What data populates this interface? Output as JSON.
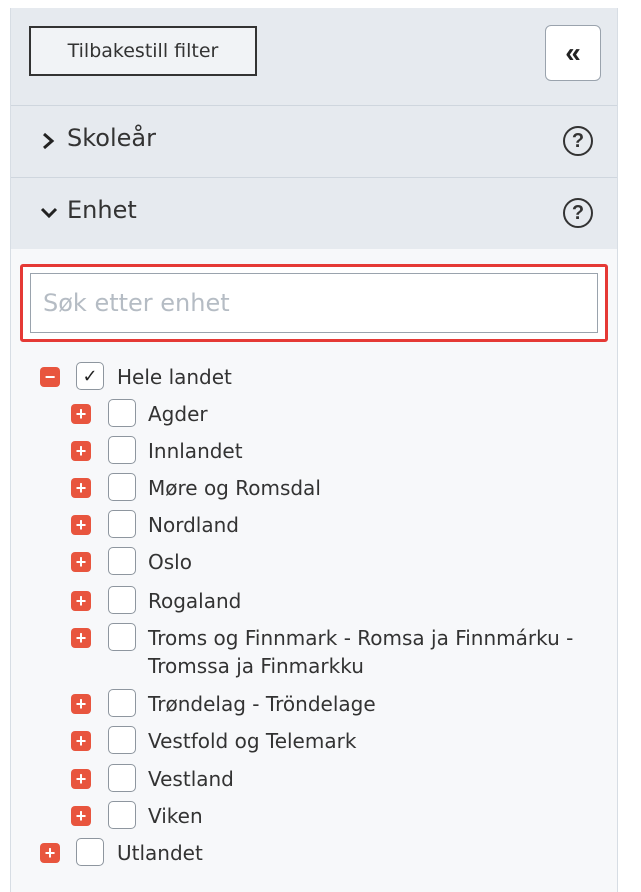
{
  "topbar": {
    "reset_label": "Tilbakestill filter",
    "collapse_glyph": "«"
  },
  "sections": [
    {
      "title": "Skoleår",
      "expanded": false,
      "help_glyph": "?"
    },
    {
      "title": "Enhet",
      "expanded": true,
      "help_glyph": "?"
    }
  ],
  "search": {
    "placeholder": "Søk etter enhet",
    "value": ""
  },
  "tree": {
    "root": {
      "label": "Hele landet",
      "checked": true,
      "expanded": true
    },
    "children": [
      {
        "label": "Agder",
        "checked": false
      },
      {
        "label": "Innlandet",
        "checked": false
      },
      {
        "label": "Møre og Romsdal",
        "checked": false
      },
      {
        "label": "Nordland",
        "checked": false
      },
      {
        "label": "Oslo",
        "checked": false
      },
      {
        "label": "Rogaland",
        "checked": false
      },
      {
        "label": "Troms og Finnmark - Romsa ja Finnmárku -",
        "label2": "Tromssa ja Finmarkku",
        "checked": false
      },
      {
        "label": "Trøndelag - Tröndelage",
        "checked": false
      },
      {
        "label": "Vestfold og Telemark",
        "checked": false
      },
      {
        "label": "Vestland",
        "checked": false
      },
      {
        "label": "Viken",
        "checked": false
      }
    ],
    "sibling": {
      "label": "Utlandet",
      "checked": false
    }
  },
  "colors": {
    "accent_red": "#e8553e",
    "focus_red": "#e53935",
    "header_bg": "#e6eaef"
  }
}
